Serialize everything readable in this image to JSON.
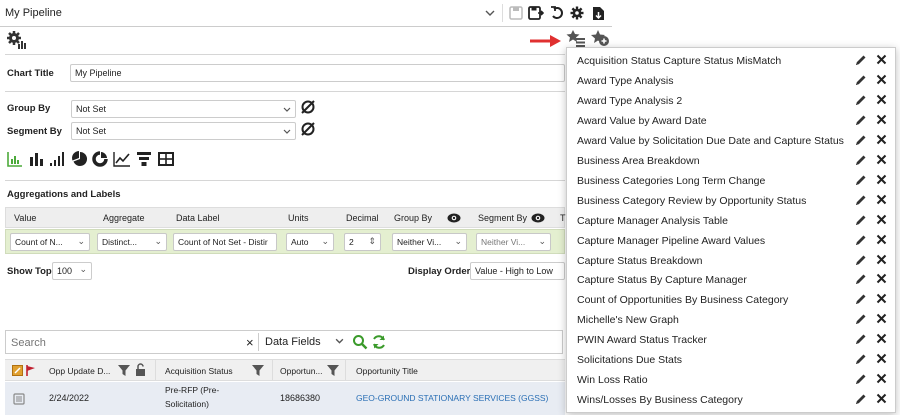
{
  "topbar": {
    "view_name": "My Pipeline",
    "icons": [
      "chevron-down-icon",
      "save-icon",
      "save-as-icon",
      "undo-icon",
      "gear-icon",
      "export-icon"
    ]
  },
  "toolbar": {
    "icon": "settings-chart-icon",
    "arrow_icon": "red-arrow-icon",
    "saved_graphs_icon": "saved-graphs-icon",
    "add_graph_icon": "add-graph-icon"
  },
  "chart_title": {
    "label": "Chart Title",
    "value": "My Pipeline"
  },
  "group_by": {
    "label": "Group By",
    "value": "Not Set"
  },
  "segment_by": {
    "label": "Segment By",
    "value": "Not Set"
  },
  "chart_types": [
    "area-chart-icon",
    "bar-chart-icon",
    "column-chart-icon",
    "pie-chart-icon",
    "donut-chart-icon",
    "line-chart-icon",
    "funnel-chart-icon",
    "table-icon"
  ],
  "aggregations": {
    "title": "Aggregations and Labels",
    "headers": [
      "Value",
      "Aggregate",
      "Data Label",
      "Units",
      "Decimal",
      "Group By",
      "Segment By",
      "T"
    ],
    "row": {
      "value": "Count of N...",
      "aggregate": "Distinct...",
      "data_label": "Count of Not Set - Distir",
      "units": "Auto",
      "decimal": "2",
      "group_by": "Neither Vi...",
      "segment_by": "Neither Vi..."
    }
  },
  "show_top": {
    "label": "Show Top:",
    "value": "100"
  },
  "display_order": {
    "label": "Display Order:",
    "value": "Value - High to Low"
  },
  "search": {
    "placeholder": "Search",
    "clear": "×",
    "fields": "Data Fields"
  },
  "grid": {
    "headers": [
      "Opp Update D...",
      "Acquisition Status",
      "Opportun...",
      "Opportunity Title"
    ],
    "row": {
      "date": "2/24/2022",
      "status_line1": "Pre-RFP (Pre-",
      "status_line2": "Solicitation)",
      "opportunity_id": "18686380",
      "title": "GEO-GROUND STATIONARY SERVICES (GGSS)"
    }
  },
  "saved_graphs": [
    "Acquisition Status Capture Status MisMatch",
    "Award Type Analysis",
    "Award Type Analysis 2",
    "Award Value by Award Date",
    "Award Value by Solicitation Due Date and Capture Status",
    "Business Area Breakdown",
    "Business Categories Long Term Change",
    "Business Category Review by Opportunity Status",
    "Capture Manager Analysis Table",
    "Capture Manager Pipeline Award Values",
    "Capture Status Breakdown",
    "Capture Status By Capture Manager",
    "Count of Opportunities By Business Category",
    "Michelle's New Graph",
    "PWIN Award Status Tracker",
    "Solicitations Due Stats",
    "Win Loss Ratio",
    "Wins/Losses By Business Category"
  ],
  "colors": {
    "accent_green": "#5cb85c",
    "selected_row": "#e4efd0",
    "link_blue": "#2a6fb5",
    "arrow_red": "#e03030"
  }
}
